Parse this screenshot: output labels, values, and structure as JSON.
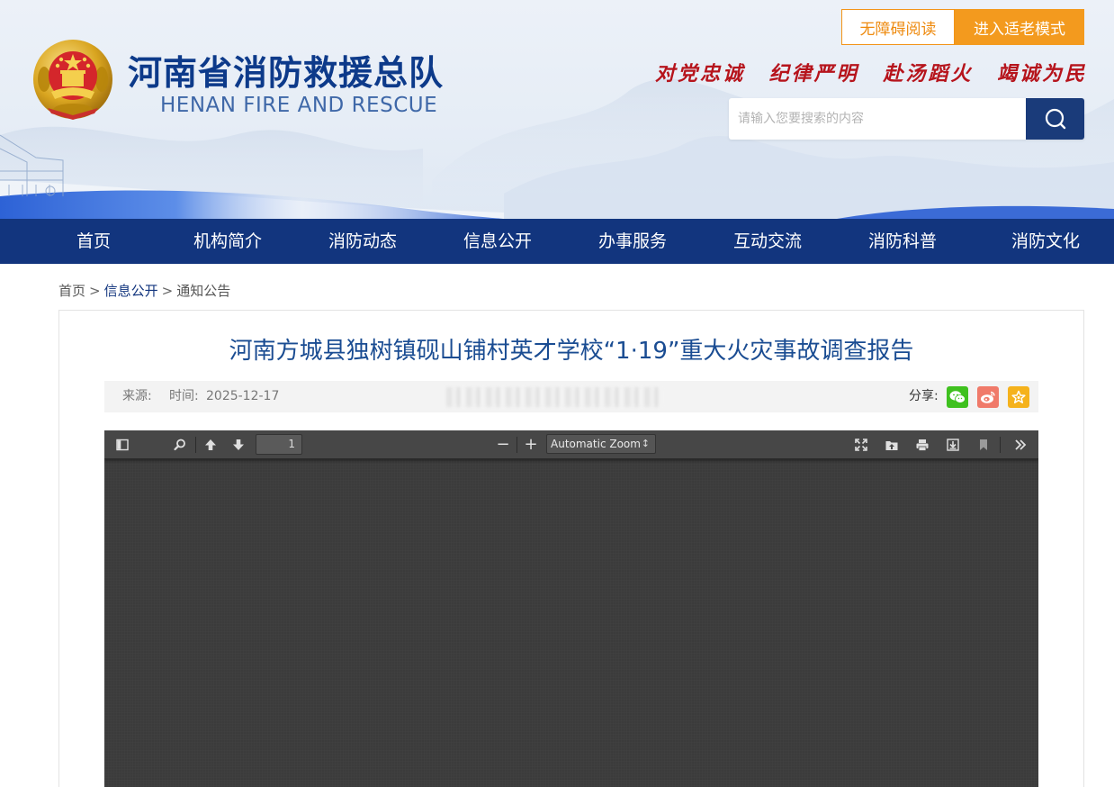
{
  "header": {
    "site_title": "河南省消防救援总队",
    "site_subtitle": "HENAN FIRE AND RESCUE",
    "accessibility_btn": "无障碍阅读",
    "elder_mode_btn": "进入适老模式",
    "slogans": [
      "对党忠诚",
      "纪律严明",
      "赴汤蹈火",
      "竭诚为民"
    ],
    "search": {
      "placeholder": "请输入您要搜索的内容",
      "value": ""
    }
  },
  "nav": {
    "items": [
      "首页",
      "机构简介",
      "消防动态",
      "信息公开",
      "办事服务",
      "互动交流",
      "消防科普",
      "消防文化"
    ]
  },
  "breadcrumb": {
    "items": [
      "首页",
      "信息公开",
      "通知公告"
    ],
    "separator": ">"
  },
  "article": {
    "title": "河南方城县独树镇砚山铺村英才学校“1·19”重大火灾事故调查报告",
    "source_label": "来源:",
    "time_label": "时间:",
    "time": "2025-12-17",
    "share_label": "分享:",
    "share_icons": [
      "wechat-icon",
      "weibo-icon",
      "favorite-icon"
    ]
  },
  "pdf_viewer": {
    "page_number": "1",
    "zoom": "Automatic Zoom",
    "zoom_out_label": "−",
    "zoom_in_label": "+"
  },
  "colors": {
    "nav_bg": "#12357e",
    "title_blue": "#1a4c92",
    "accent_orange": "#f39a1e",
    "slogan_red": "#b6141c"
  }
}
